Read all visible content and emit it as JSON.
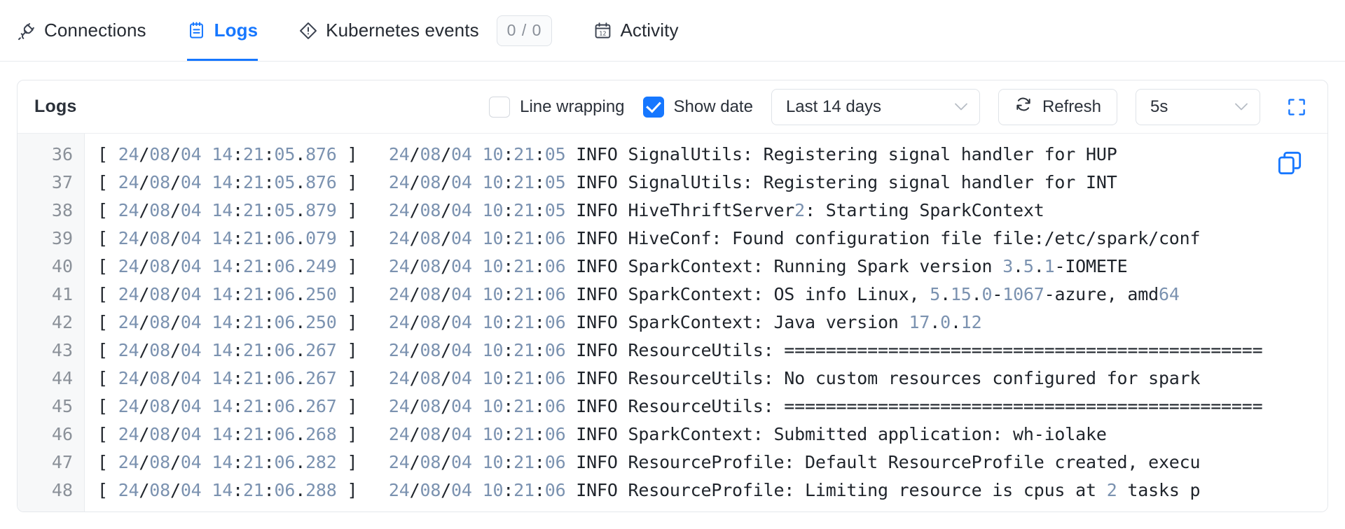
{
  "tabs": [
    {
      "id": "connections",
      "label": "Connections",
      "icon": "plug-icon",
      "active": false,
      "badge": null
    },
    {
      "id": "logs",
      "label": "Logs",
      "icon": "notepad-icon",
      "active": true,
      "badge": null
    },
    {
      "id": "kubernetes-events",
      "label": "Kubernetes events",
      "icon": "diamond-alert-icon",
      "active": false,
      "badge": "0 / 0"
    },
    {
      "id": "activity",
      "label": "Activity",
      "icon": "calendar-icon",
      "active": false,
      "badge": null
    }
  ],
  "panel": {
    "title": "Logs",
    "line_wrapping": {
      "label": "Line wrapping",
      "checked": false
    },
    "show_date": {
      "label": "Show date",
      "checked": true
    },
    "time_range": {
      "value": "Last 14 days"
    },
    "refresh": {
      "label": "Refresh"
    },
    "interval": {
      "value": "5s"
    },
    "fullscreen_icon": "expand-icon",
    "copy_icon": "copy-icon"
  },
  "colors": {
    "accent": "#1677ff",
    "text": "#1f242b",
    "muted": "#8b9199",
    "log_number": "#7b92b0",
    "border": "#e5e8ec"
  },
  "log_lines": [
    {
      "no": "36",
      "text": "[ 24/08/04 14:21:05.876 ]   24/08/04 10:21:05 INFO SignalUtils: Registering signal handler for HUP"
    },
    {
      "no": "37",
      "text": "[ 24/08/04 14:21:05.876 ]   24/08/04 10:21:05 INFO SignalUtils: Registering signal handler for INT"
    },
    {
      "no": "38",
      "text": "[ 24/08/04 14:21:05.879 ]   24/08/04 10:21:05 INFO HiveThriftServer2: Starting SparkContext"
    },
    {
      "no": "39",
      "text": "[ 24/08/04 14:21:06.079 ]   24/08/04 10:21:06 INFO HiveConf: Found configuration file file:/etc/spark/conf"
    },
    {
      "no": "40",
      "text": "[ 24/08/04 14:21:06.249 ]   24/08/04 10:21:06 INFO SparkContext: Running Spark version 3.5.1-IOMETE"
    },
    {
      "no": "41",
      "text": "[ 24/08/04 14:21:06.250 ]   24/08/04 10:21:06 INFO SparkContext: OS info Linux, 5.15.0-1067-azure, amd64"
    },
    {
      "no": "42",
      "text": "[ 24/08/04 14:21:06.250 ]   24/08/04 10:21:06 INFO SparkContext: Java version 17.0.12"
    },
    {
      "no": "43",
      "text": "[ 24/08/04 14:21:06.267 ]   24/08/04 10:21:06 INFO ResourceUtils: =============================================="
    },
    {
      "no": "44",
      "text": "[ 24/08/04 14:21:06.267 ]   24/08/04 10:21:06 INFO ResourceUtils: No custom resources configured for spark"
    },
    {
      "no": "45",
      "text": "[ 24/08/04 14:21:06.267 ]   24/08/04 10:21:06 INFO ResourceUtils: =============================================="
    },
    {
      "no": "46",
      "text": "[ 24/08/04 14:21:06.268 ]   24/08/04 10:21:06 INFO SparkContext: Submitted application: wh-iolake"
    },
    {
      "no": "47",
      "text": "[ 24/08/04 14:21:06.282 ]   24/08/04 10:21:06 INFO ResourceProfile: Default ResourceProfile created, execu"
    },
    {
      "no": "48",
      "text": "[ 24/08/04 14:21:06.288 ]   24/08/04 10:21:06 INFO ResourceProfile: Limiting resource is cpus at 2 tasks p"
    }
  ]
}
